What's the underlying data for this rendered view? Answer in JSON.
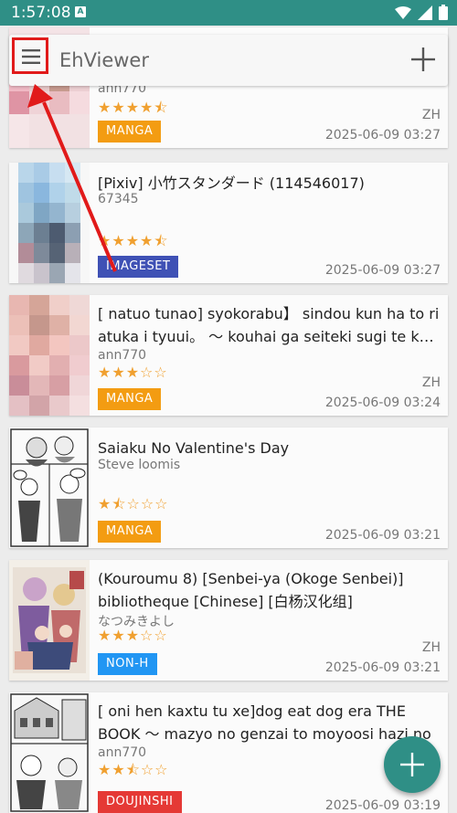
{
  "status_bar": {
    "time": "1:57:08"
  },
  "toolbar": {
    "title": "EhViewer",
    "menu_icon": "menu-icon",
    "add_icon": "plus-icon"
  },
  "colors": {
    "accent": "#2f8f86",
    "star": "#f0a030",
    "manga": "#f39c12",
    "imageset": "#3f51b5",
    "non_h": "#2196f3",
    "doujinshi": "#e53935",
    "highlight": "#e11a1a"
  },
  "galleries": [
    {
      "title": "",
      "uploader": "ann770",
      "stars": "★★★★⯪",
      "category": "MANGA",
      "language": "ZH",
      "date": "2025-06-09 03:27"
    },
    {
      "title": "[Pixiv] 小竹スタンダード (114546017)",
      "uploader": "67345",
      "stars": "★★★★⯪",
      "category": "IMAGESET",
      "language": "",
      "date": "2025-06-09 03:27"
    },
    {
      "title": "[ natuo tunao] syokorabu】 sindou kun ha to ri atuka i tyuui。 ～ kouhai ga seiteki sugi te k…",
      "uploader": "ann770",
      "stars": "★★★☆☆",
      "category": "MANGA",
      "language": "ZH",
      "date": "2025-06-09 03:24"
    },
    {
      "title": "Saiaku No Valentine's Day",
      "uploader": "Steve loomis",
      "stars": "★⯪☆☆☆",
      "category": "MANGA",
      "language": "",
      "date": "2025-06-09 03:21"
    },
    {
      "title": "(Kouroumu 8) [Senbei-ya (Okoge Senbei)] bibliotheque [Chinese] [白杨汉化组]",
      "uploader": "なつみきよし",
      "stars": "★★★☆☆",
      "category": "NON-H",
      "language": "ZH",
      "date": "2025-06-09 03:21"
    },
    {
      "title": "[ oni hen kaxtu tu xe]dog eat dog era THE BOOK ～ mazyo no genzai to moyoosi hazi no dorei …",
      "uploader": "ann770",
      "stars": "★★⯪☆☆",
      "category": "DOUJINSHI",
      "language": "",
      "date": "2025-06-09 03:19"
    }
  ],
  "fab": {
    "icon": "plus-icon"
  }
}
